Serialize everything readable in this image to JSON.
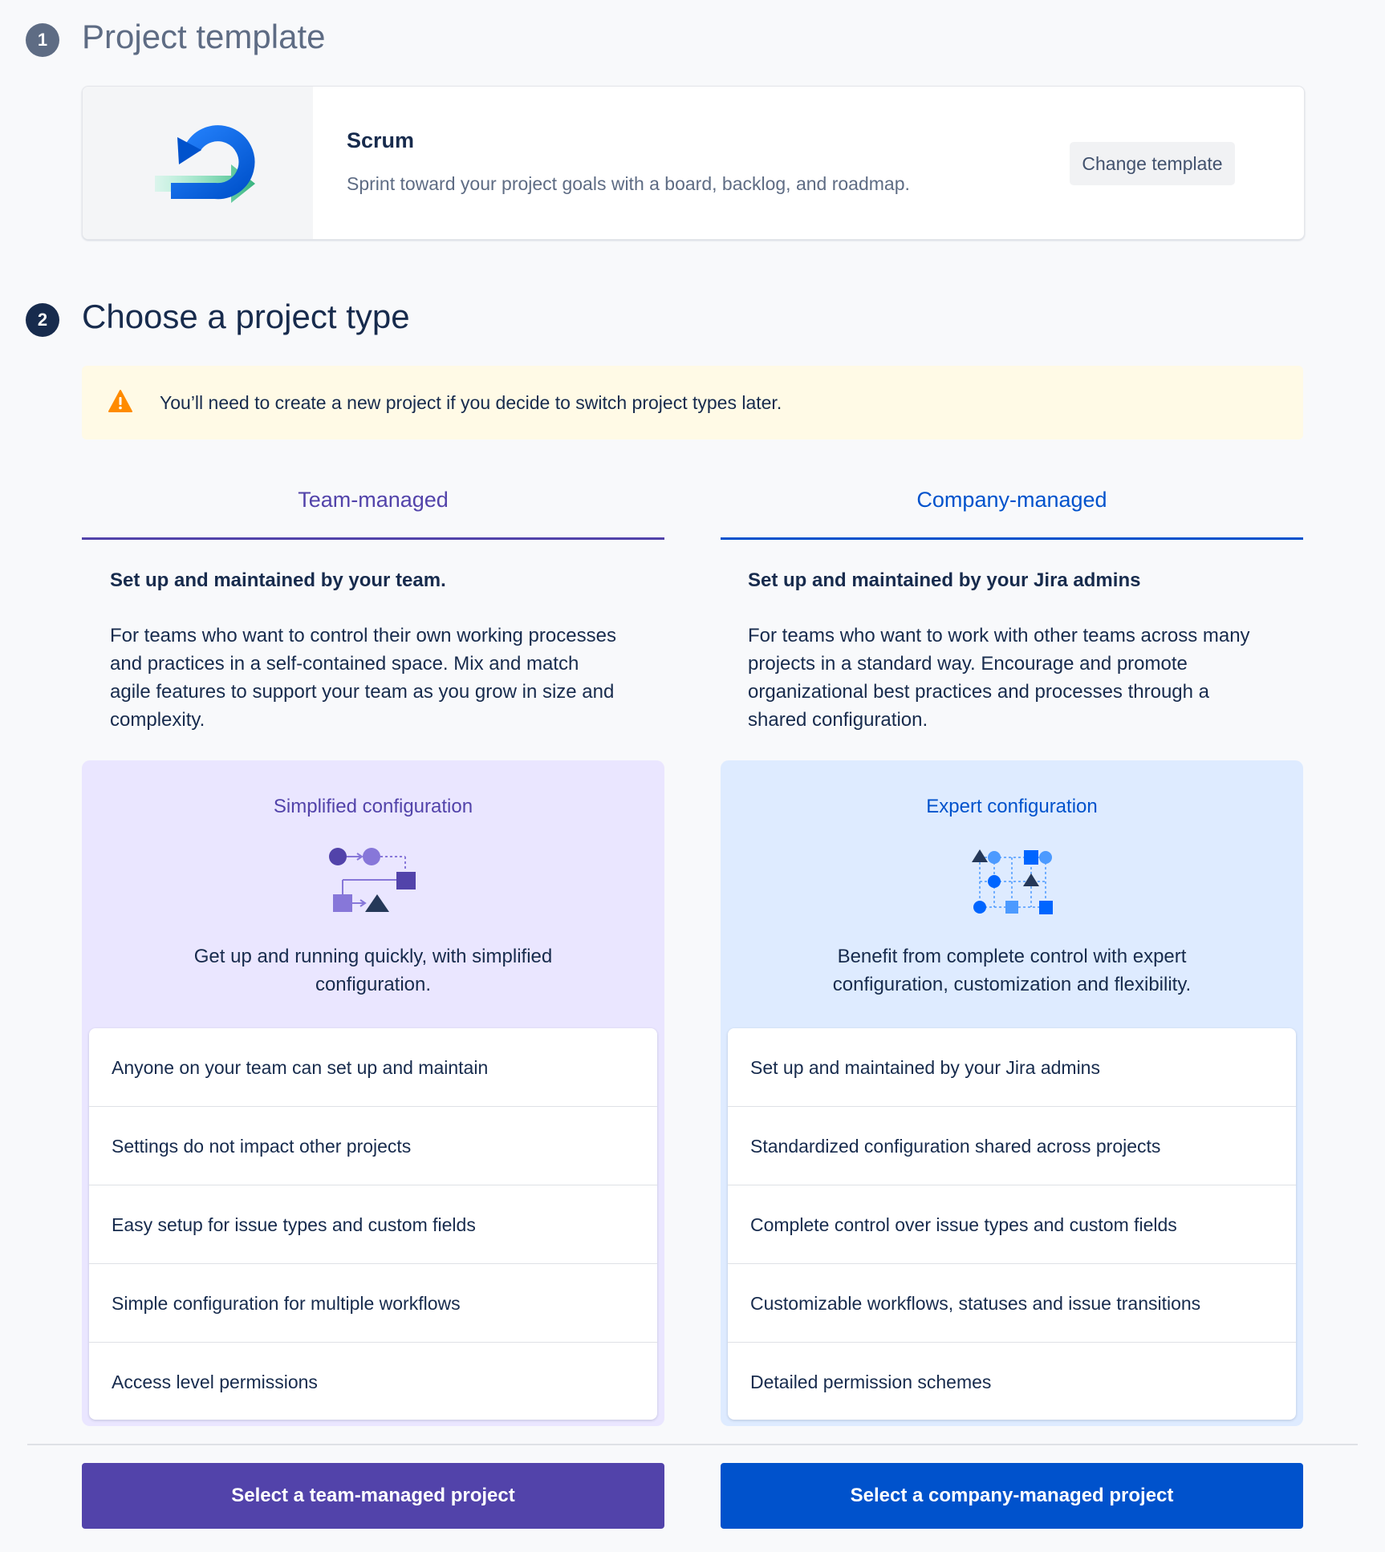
{
  "step1": {
    "number": "1",
    "title": "Project template"
  },
  "template": {
    "name": "Scrum",
    "description": "Sprint toward your project goals with a board, backlog, and roadmap.",
    "change_label": "Change template",
    "icon": "scrum-cycle-icon"
  },
  "step2": {
    "number": "2",
    "title": "Choose a project type"
  },
  "warning": {
    "icon": "warning-icon",
    "text": "You’ll need to create a new project if you decide to switch project types later."
  },
  "colors": {
    "team_accent": "#5243AA",
    "company_accent": "#0052CC",
    "team_panel": "#EAE6FF",
    "company_panel": "#DEEBFF",
    "warning_bg": "#FFFAE6"
  },
  "team": {
    "tab_label": "Team-managed",
    "heading": "Set up and maintained by your team.",
    "description": "For teams who want to control their own working processes and practices in a self-contained space. Mix and match agile features to support your team as you grow in size and complexity.",
    "config_title": "Simplified configuration",
    "config_icon": "simplified-workflow-icon",
    "config_desc": "Get up and running quickly, with simplified configuration.",
    "features": [
      "Anyone on your team can set up and maintain",
      "Settings do not impact other projects",
      "Easy setup for issue types and custom fields",
      "Simple configuration for multiple workflows",
      "Access level permissions"
    ],
    "select_label": "Select a team-managed project"
  },
  "company": {
    "tab_label": "Company-managed",
    "heading": "Set up and maintained by your Jira admins",
    "description": "For teams who want to work with other teams across many projects in a standard way. Encourage and promote organizational best practices and processes through a shared configuration.",
    "config_title": "Expert configuration",
    "config_icon": "expert-workflow-icon",
    "config_desc": "Benefit from complete control with expert configuration, customization and flexibility.",
    "features": [
      "Set up and maintained by your Jira admins",
      "Standardized configuration shared across projects",
      "Complete control over issue types and custom fields",
      "Customizable workflows, statuses and issue transitions",
      "Detailed permission schemes"
    ],
    "select_label": "Select a company-managed project"
  }
}
